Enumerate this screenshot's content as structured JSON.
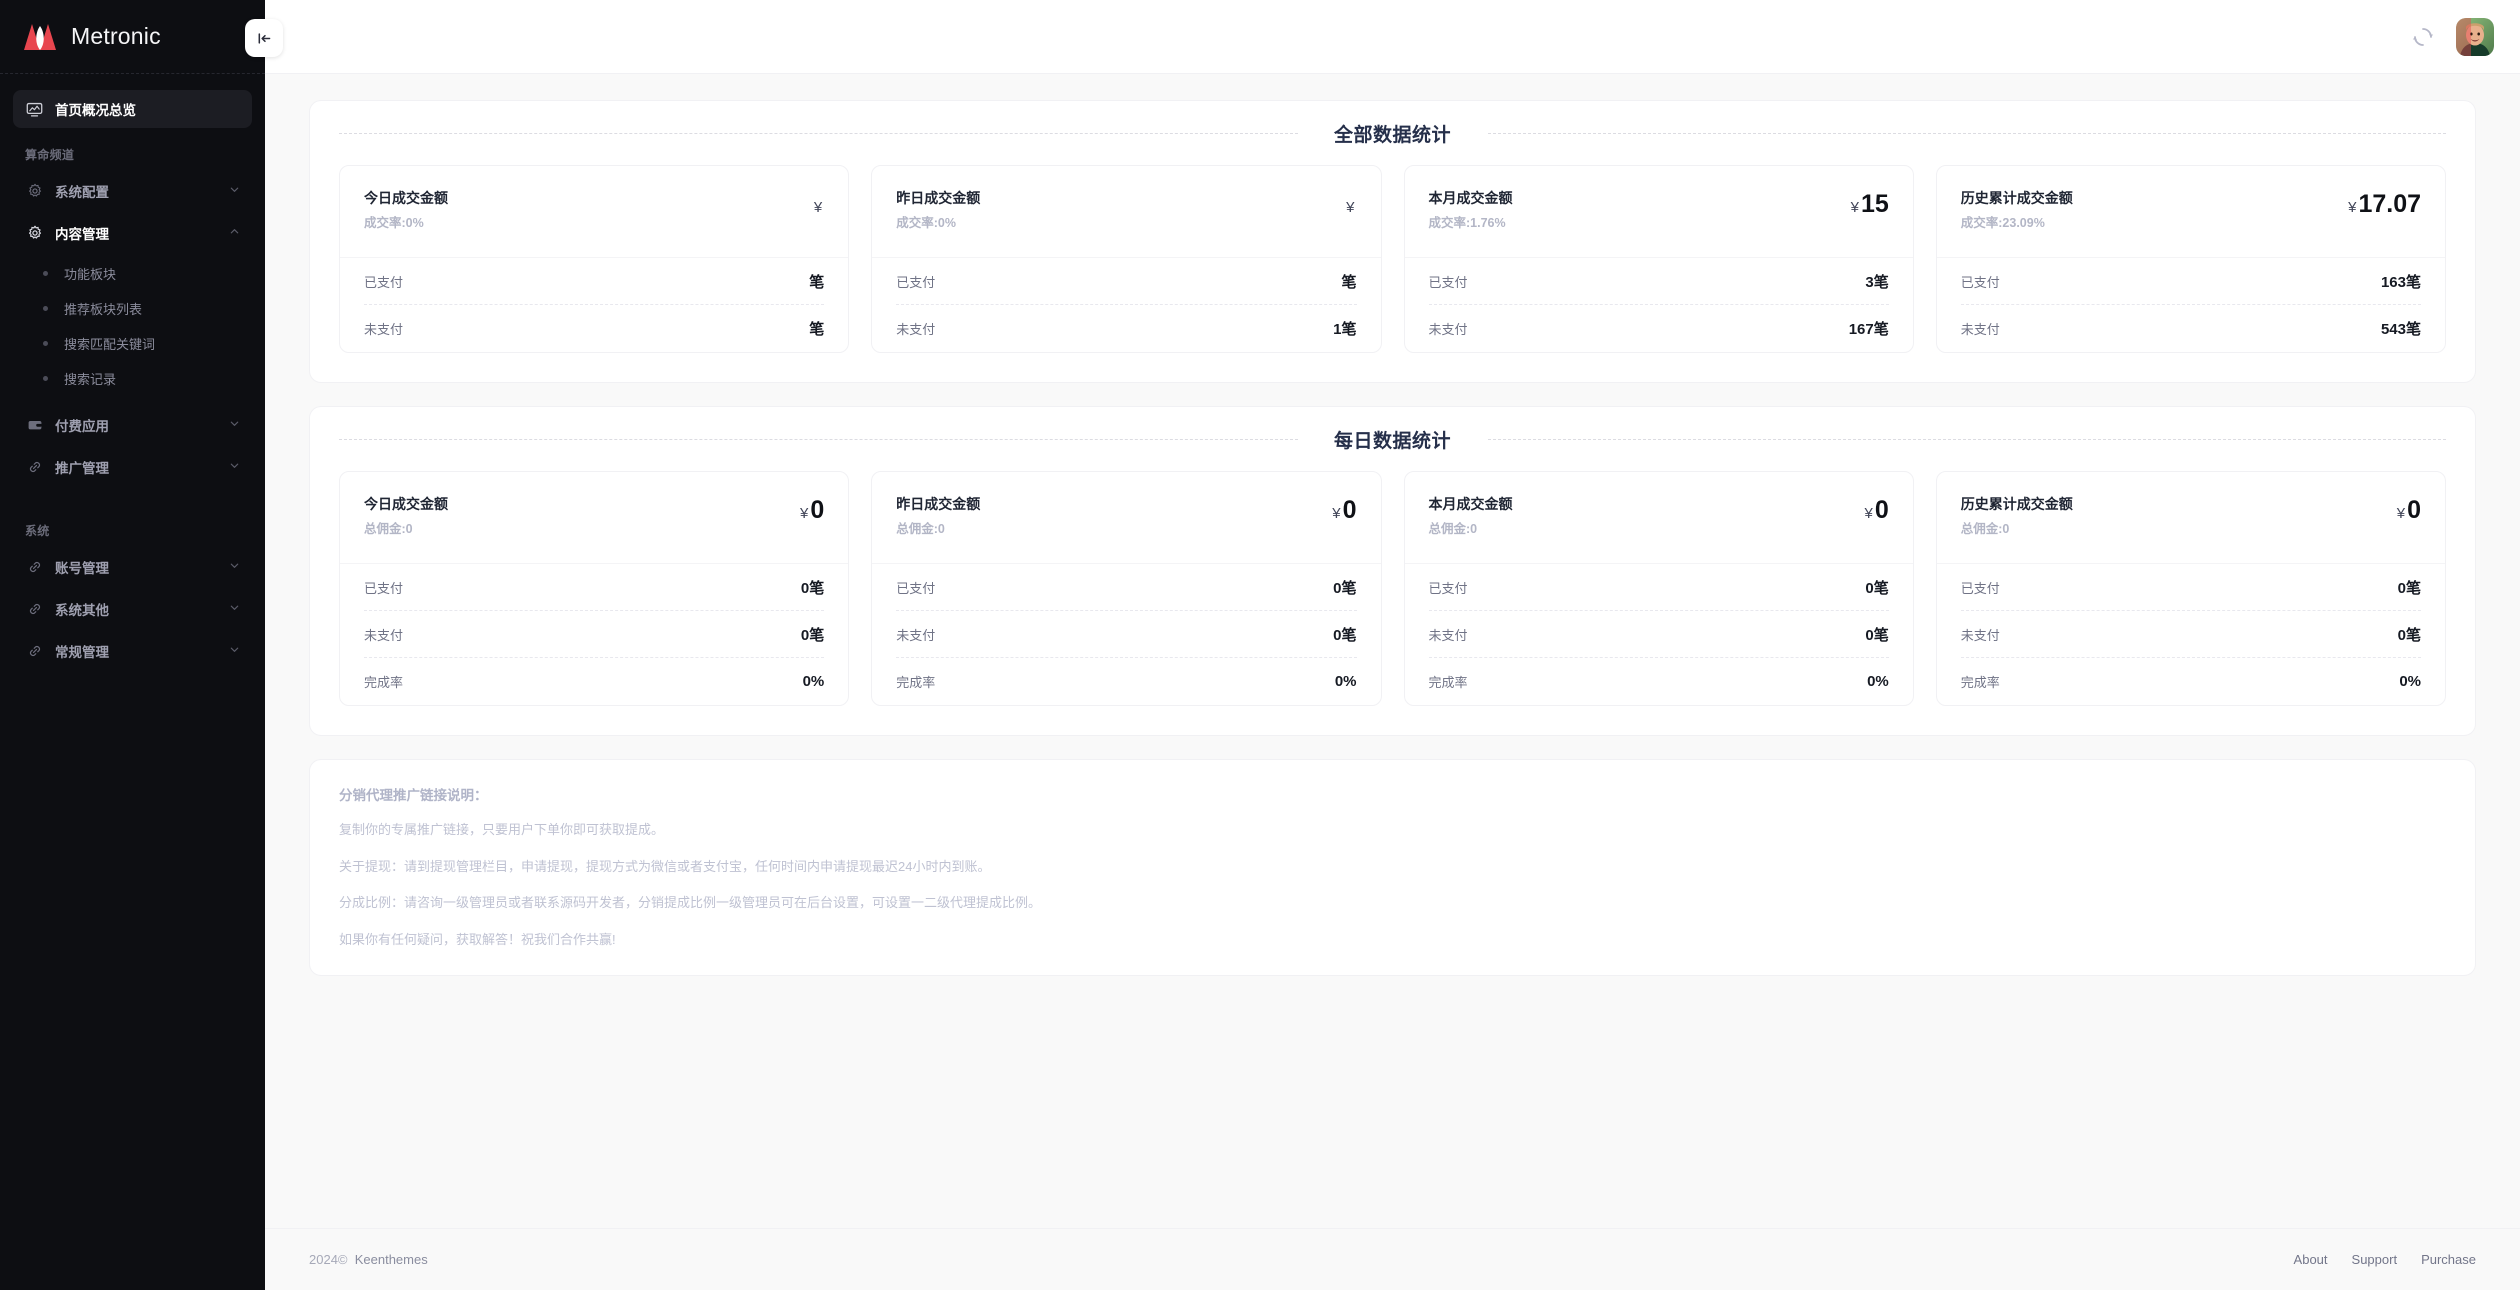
{
  "brand": {
    "name": "Metronic"
  },
  "sidebar": {
    "collapse_icon": "collapse-left-icon",
    "dashboard": {
      "label": "首页概况总览",
      "icon": "monitor-icon"
    },
    "group_1_heading": "算命频道",
    "group_1_items": [
      {
        "label": "系统配置",
        "icon": "gear-icon",
        "arrow": "chevron-down"
      },
      {
        "label": "内容管理",
        "icon": "gear-icon",
        "arrow": "chevron-up"
      }
    ],
    "content_children": [
      {
        "label": "功能板块"
      },
      {
        "label": "推荐板块列表"
      },
      {
        "label": "搜索匹配关键词"
      },
      {
        "label": "搜索记录"
      }
    ],
    "group_1_items_after": [
      {
        "label": "付费应用",
        "icon": "wallet-icon",
        "arrow": "chevron-down"
      },
      {
        "label": "推广管理",
        "icon": "link-icon",
        "arrow": "chevron-down"
      }
    ],
    "group_2_heading": "系统",
    "group_2_items": [
      {
        "label": "账号管理",
        "icon": "link-icon",
        "arrow": "chevron-down"
      },
      {
        "label": "系统其他",
        "icon": "link-icon",
        "arrow": "chevron-down"
      },
      {
        "label": "常规管理",
        "icon": "link-icon",
        "arrow": "chevron-down"
      }
    ]
  },
  "topbar": {
    "spinner_icon": "loading-spinner-icon",
    "avatar_icon": "user-avatar"
  },
  "sections": [
    {
      "title": "全部数据统计",
      "cards": [
        {
          "name": "今日成交金额",
          "sub": "成交率:0%",
          "currency": "¥",
          "amount": "",
          "rows": [
            {
              "label": "已支付",
              "value": "笔"
            },
            {
              "label": "未支付",
              "value": "笔"
            }
          ]
        },
        {
          "name": "昨日成交金额",
          "sub": "成交率:0%",
          "currency": "¥",
          "amount": "",
          "rows": [
            {
              "label": "已支付",
              "value": "笔"
            },
            {
              "label": "未支付",
              "value": "1笔"
            }
          ]
        },
        {
          "name": "本月成交金额",
          "sub": "成交率:1.76%",
          "currency": "¥",
          "amount": "15",
          "rows": [
            {
              "label": "已支付",
              "value": "3笔"
            },
            {
              "label": "未支付",
              "value": "167笔"
            }
          ]
        },
        {
          "name": "历史累计成交金额",
          "sub": "成交率:23.09%",
          "currency": "¥",
          "amount": "17.07",
          "rows": [
            {
              "label": "已支付",
              "value": "163笔"
            },
            {
              "label": "未支付",
              "value": "543笔"
            }
          ]
        }
      ]
    },
    {
      "title": "每日数据统计",
      "cards": [
        {
          "name": "今日成交金额",
          "sub": "总佣金:0",
          "currency": "¥",
          "amount": "0",
          "rows": [
            {
              "label": "已支付",
              "value": "0笔"
            },
            {
              "label": "未支付",
              "value": "0笔"
            },
            {
              "label": "完成率",
              "value": "0%"
            }
          ]
        },
        {
          "name": "昨日成交金额",
          "sub": "总佣金:0",
          "currency": "¥",
          "amount": "0",
          "rows": [
            {
              "label": "已支付",
              "value": "0笔"
            },
            {
              "label": "未支付",
              "value": "0笔"
            },
            {
              "label": "完成率",
              "value": "0%"
            }
          ]
        },
        {
          "name": "本月成交金额",
          "sub": "总佣金:0",
          "currency": "¥",
          "amount": "0",
          "rows": [
            {
              "label": "已支付",
              "value": "0笔"
            },
            {
              "label": "未支付",
              "value": "0笔"
            },
            {
              "label": "完成率",
              "value": "0%"
            }
          ]
        },
        {
          "name": "历史累计成交金额",
          "sub": "总佣金:0",
          "currency": "¥",
          "amount": "0",
          "rows": [
            {
              "label": "已支付",
              "value": "0笔"
            },
            {
              "label": "未支付",
              "value": "0笔"
            },
            {
              "label": "完成率",
              "value": "0%"
            }
          ]
        }
      ]
    }
  ],
  "notice": {
    "title": "分销代理推广链接说明：",
    "lines": [
      "复制你的专属推广链接，只要用户下单你即可获取提成。",
      "关于提现：请到提现管理栏目，申请提现，提现方式为微信或者支付宝，任何时间内申请提现最迟24小时内到账。",
      "分成比例：请咨询一级管理员或者联系源码开发者，分销提成比例一级管理员可在后台设置，可设置一二级代理提成比例。",
      "如果你有任何疑问，获取解答！祝我们合作共赢!"
    ]
  },
  "footer": {
    "year": "2024©",
    "company": "Keenthemes",
    "links": [
      "About",
      "Support",
      "Purchase"
    ]
  },
  "colors": {
    "sidebar_bg": "#0d0e12",
    "page_bg": "#f9f9f9",
    "accent_red": "#e8464f",
    "title_color": "#252f4a"
  }
}
